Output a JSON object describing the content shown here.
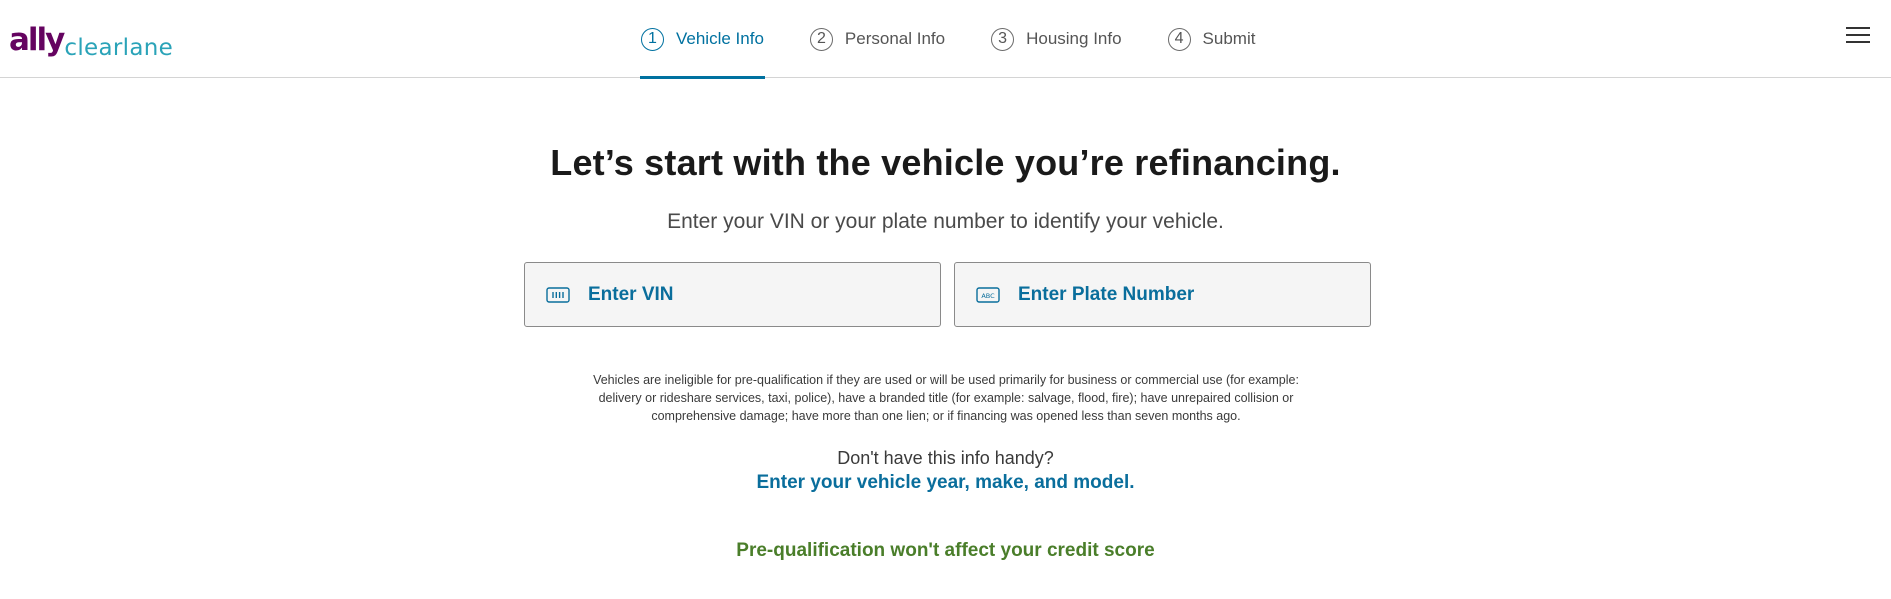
{
  "brand": {
    "ally": "ally",
    "clearlane": "clearlane"
  },
  "steps": [
    {
      "num": "1",
      "label": "Vehicle Info",
      "active": true
    },
    {
      "num": "2",
      "label": "Personal Info",
      "active": false
    },
    {
      "num": "3",
      "label": "Housing Info",
      "active": false
    },
    {
      "num": "4",
      "label": "Submit",
      "active": false
    }
  ],
  "main": {
    "title": "Let’s start with the vehicle you’re refinancing.",
    "subtitle": "Enter your VIN or your plate number to identify your vehicle.",
    "vin_button": {
      "label": "Enter VIN",
      "icon": "barcode-card-icon"
    },
    "plate_button": {
      "label": "Enter Plate Number",
      "icon": "license-plate-icon",
      "icon_text": "ABC"
    },
    "disclaimer": "Vehicles are ineligible for pre-qualification if they are used or will be used primarily for business or commercial use (for example: delivery or rideshare services, taxi, police), have a  branded title (for example: salvage, flood, fire); have unrepaired collision or comprehensive damage; have more than one lien;  or if financing was opened less than seven months ago.",
    "no_info_text": "Don't have this info handy?",
    "manual_link": "Enter your vehicle year, make, and model.",
    "prequal_note": "Pre-qualification won't affect your credit score"
  },
  "colors": {
    "brand_purple": "#650360",
    "brand_teal": "#2aa3b8",
    "accent_blue": "#0071a0",
    "link_blue": "#0a6e9c",
    "success_green": "#4a7e2a"
  }
}
